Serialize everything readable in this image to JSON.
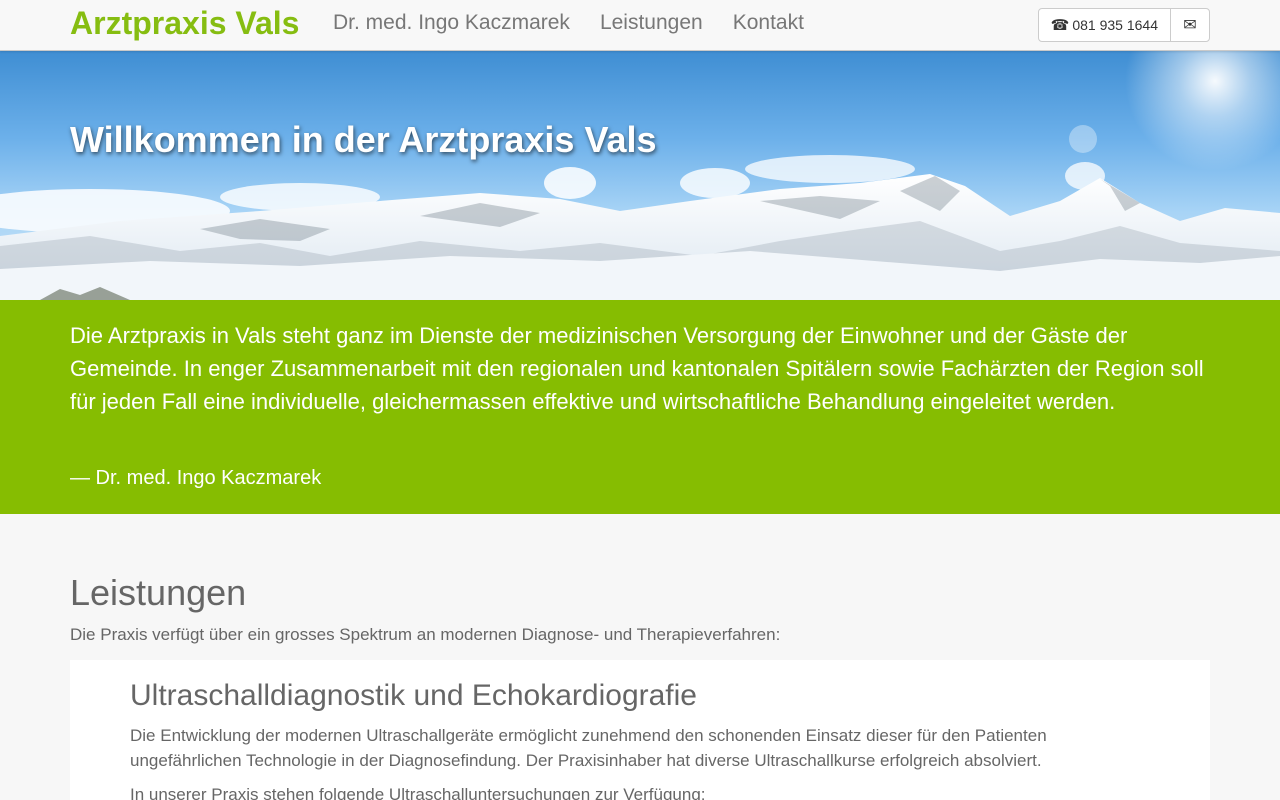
{
  "nav": {
    "brand": "Arztpraxis Vals",
    "links": [
      "Dr. med. Ingo Kaczmarek",
      "Leistungen",
      "Kontakt"
    ],
    "phone_icon": "phone-icon",
    "phone": "081 935 1644",
    "mail_icon": "envelope-icon"
  },
  "hero": {
    "title": "Willkommen in der Arztpraxis Vals"
  },
  "quote": {
    "text": "Die Arztpraxis in Vals steht ganz im Dienste der medizinischen Versorgung der Einwohner und der Gäste der Gemeinde. In enger Zusammenarbeit mit den regionalen und kantonalen Spitälern sowie Fachärzten der Region soll für jeden Fall eine individuelle, gleichermassen effektive und wirtschaftliche Behandlung eingeleitet werden.",
    "author": "— Dr. med. Ingo Kaczmarek"
  },
  "services": {
    "title": "Leistungen",
    "intro": "Die Praxis verfügt über ein grosses Spektrum an modernen Diagnose- und Therapieverfahren:",
    "items": [
      {
        "title": "Ultraschalldiagnostik und Echokardiografie",
        "text": "Die Entwicklung der modernen Ultraschallgeräte ermöglicht zunehmend den schonenden Einsatz dieser für den Patienten ungefährlichen Technologie in der Diagnosefindung. Der Praxisinhaber hat diverse Ultraschallkurse erfolgreich absolviert.",
        "text2": "In unserer Praxis stehen folgende Ultraschalluntersuchungen zur Verfügung:"
      }
    ]
  },
  "colors": {
    "accent": "#86bd01",
    "text": "#666666",
    "nav_bg": "#f8f8f8"
  }
}
